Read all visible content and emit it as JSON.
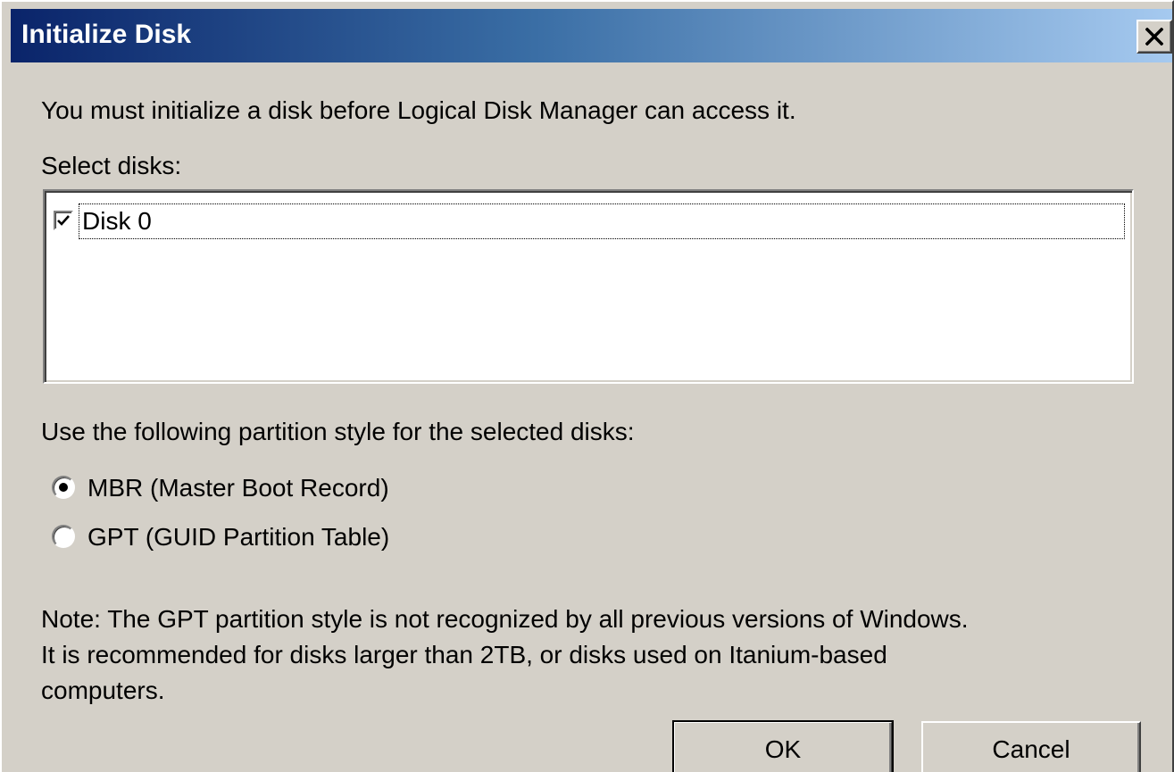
{
  "window": {
    "title": "Initialize Disk",
    "close_icon": "close-x-icon",
    "titlebar_gradient": [
      "#0a246a",
      "#3a6ea5",
      "#a6caf0"
    ],
    "face_color": "#d4d0c8"
  },
  "intro_text": "You must initialize a disk before Logical Disk Manager can access it.",
  "select_disks": {
    "label": "Select disks:",
    "items": [
      {
        "label": "Disk 0",
        "checked": true,
        "icon": "checkmark-icon"
      }
    ]
  },
  "partition": {
    "label": "Use the following partition style for the selected disks:",
    "options": [
      {
        "label": "MBR (Master Boot Record)",
        "selected": true
      },
      {
        "label": "GPT (GUID Partition Table)",
        "selected": false
      }
    ]
  },
  "note": {
    "lines": [
      "Note: The GPT partition style is not recognized by all previous versions of Windows.",
      "It is recommended for disks larger than 2TB, or disks used on Itanium-based",
      "computers."
    ]
  },
  "buttons": {
    "ok_label": "OK",
    "cancel_label": "Cancel"
  }
}
